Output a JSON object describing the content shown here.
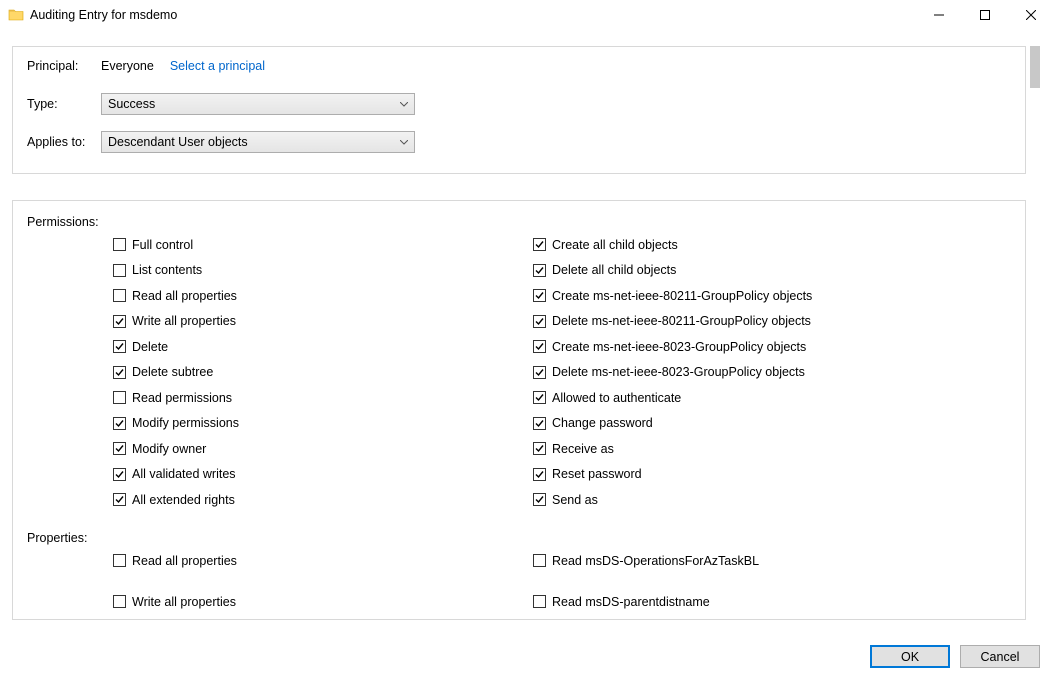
{
  "window": {
    "title": "Auditing Entry for msdemo"
  },
  "top": {
    "principal_label": "Principal:",
    "principal_value": "Everyone",
    "principal_link": "Select a principal",
    "type_label": "Type:",
    "type_value": "Success",
    "applies_label": "Applies to:",
    "applies_value": "Descendant User objects"
  },
  "permissions": {
    "header": "Permissions:",
    "left": [
      {
        "label": "Full control",
        "checked": false
      },
      {
        "label": "List contents",
        "checked": false
      },
      {
        "label": "Read all properties",
        "checked": false
      },
      {
        "label": "Write all properties",
        "checked": true
      },
      {
        "label": "Delete",
        "checked": true
      },
      {
        "label": "Delete subtree",
        "checked": true
      },
      {
        "label": "Read permissions",
        "checked": false
      },
      {
        "label": "Modify permissions",
        "checked": true
      },
      {
        "label": "Modify owner",
        "checked": true
      },
      {
        "label": "All validated writes",
        "checked": true
      },
      {
        "label": "All extended rights",
        "checked": true
      }
    ],
    "right": [
      {
        "label": "Create all child objects",
        "checked": true
      },
      {
        "label": "Delete all child objects",
        "checked": true
      },
      {
        "label": "Create ms-net-ieee-80211-GroupPolicy objects",
        "checked": true
      },
      {
        "label": "Delete ms-net-ieee-80211-GroupPolicy objects",
        "checked": true
      },
      {
        "label": "Create ms-net-ieee-8023-GroupPolicy objects",
        "checked": true
      },
      {
        "label": "Delete ms-net-ieee-8023-GroupPolicy objects",
        "checked": true
      },
      {
        "label": "Allowed to authenticate",
        "checked": true
      },
      {
        "label": "Change password",
        "checked": true
      },
      {
        "label": "Receive as",
        "checked": true
      },
      {
        "label": "Reset password",
        "checked": true
      },
      {
        "label": "Send as",
        "checked": true
      }
    ]
  },
  "properties": {
    "header": "Properties:",
    "left": [
      {
        "label": "Read all properties",
        "checked": false
      },
      {
        "label": "Write all properties",
        "checked": false
      }
    ],
    "right": [
      {
        "label": "Read msDS-OperationsForAzTaskBL",
        "checked": false
      },
      {
        "label": "Read msDS-parentdistname",
        "checked": false
      }
    ]
  },
  "footer": {
    "ok": "OK",
    "cancel": "Cancel"
  }
}
